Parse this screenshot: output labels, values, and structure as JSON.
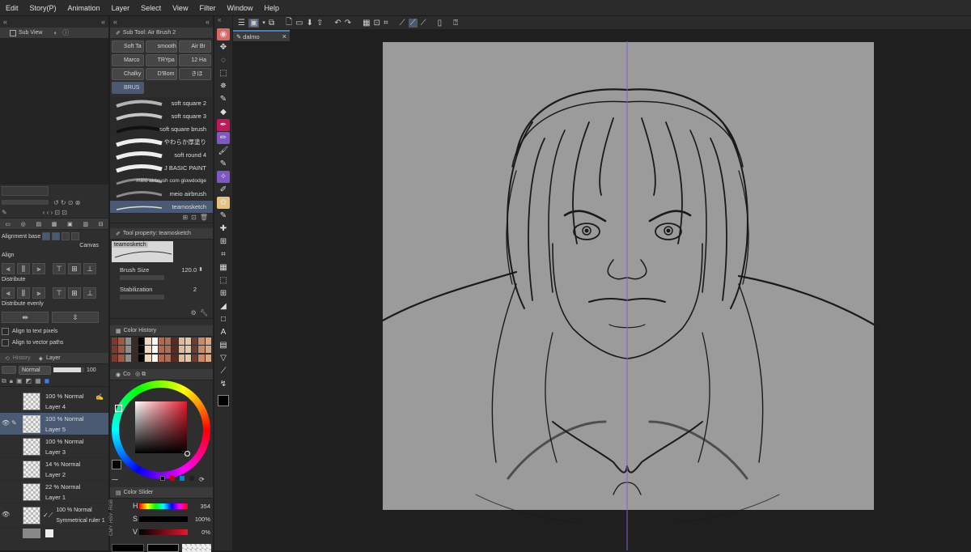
{
  "menu": [
    "Edit",
    "Story(P)",
    "Animation",
    "Layer",
    "Select",
    "View",
    "Filter",
    "Window",
    "Help"
  ],
  "canvas_tab": {
    "name": "dalmo",
    "close": "×"
  },
  "subview": {
    "title": "Sub View"
  },
  "subtool": {
    "title": "Sub Tool: Air Brush 2",
    "tabs": [
      "Soft Ta",
      "smooth",
      "Air Br",
      "Marco",
      "TRYpa",
      "12 Ha",
      "Chalky",
      "D'Bom",
      "きほ",
      "BRUS"
    ],
    "brushes": [
      "soft square 2",
      "soft square 3",
      "soft square brush",
      "やわらか厚塗り",
      "soft round 4",
      "J BASIC PAINT",
      "meio airbrush com glowdodge",
      "meio airbrush",
      "teamosketch"
    ]
  },
  "tool_property": {
    "title": "Tool property: teamosketch",
    "brush_name": "teamosketch",
    "brush_size_label": "Brush Size",
    "brush_size_value": "120.0",
    "stabilization_label": "Stabilization",
    "stabilization_value": "2"
  },
  "align_panel": {
    "alignment_base_label": "Alignment base",
    "canvas_label": "Canvas",
    "align_label": "Align",
    "distribute_label": "Distribute",
    "distribute_evenly_label": "Distribute evenly",
    "align_text_label": "Align to text pixels",
    "align_vector_label": "Align to vector paths"
  },
  "color_history": {
    "title": "Color History"
  },
  "color_wheel": {
    "title": "Co"
  },
  "color_slider": {
    "title": "Color Slider",
    "side_labels": [
      "RGB",
      "HSV",
      "CMY"
    ],
    "h_label": "H",
    "h_value": "354",
    "s_label": "S",
    "s_value": "100",
    "v_label": "V",
    "v_value": "0",
    "percent": "%"
  },
  "layer_panel": {
    "tabs": [
      "History",
      "Layer"
    ],
    "blend_mode": "Normal",
    "opacity": "100",
    "layers": [
      {
        "opacity": "100 % Normal",
        "name": "Layer 4"
      },
      {
        "opacity": "100 % Normal",
        "name": "Layer 5"
      },
      {
        "opacity": "100 % Normal",
        "name": "Layer 3"
      },
      {
        "opacity": "14 % Normal",
        "name": "Layer 2"
      },
      {
        "opacity": "22 % Normal",
        "name": "Layer 1"
      },
      {
        "opacity": "100 % Normal",
        "name": "Symmetrical ruler 1"
      }
    ]
  },
  "colors": {
    "accent": "#4b5a73",
    "canvas_bg": "#9b9b9b",
    "ruler": "#8a5cd6",
    "main_color": "#000000",
    "hue_current": "#e21a2e"
  }
}
